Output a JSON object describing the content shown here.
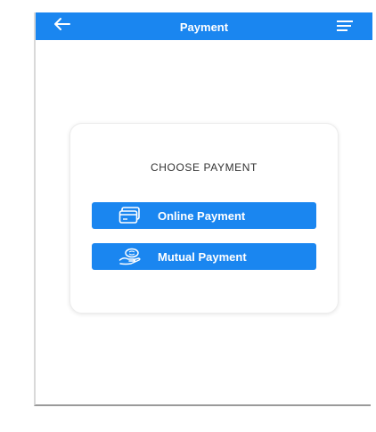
{
  "header": {
    "title": "Payment",
    "back_icon": "arrow-left-icon",
    "menu_icon": "hamburger-menu-icon",
    "color": "#1a86f0"
  },
  "card": {
    "title": "CHOOSE  PAYMENT",
    "buttons": [
      {
        "label": "Online Payment",
        "icon": "credit-card-icon"
      },
      {
        "label": "Mutual Payment",
        "icon": "hand-money-icon"
      }
    ]
  }
}
